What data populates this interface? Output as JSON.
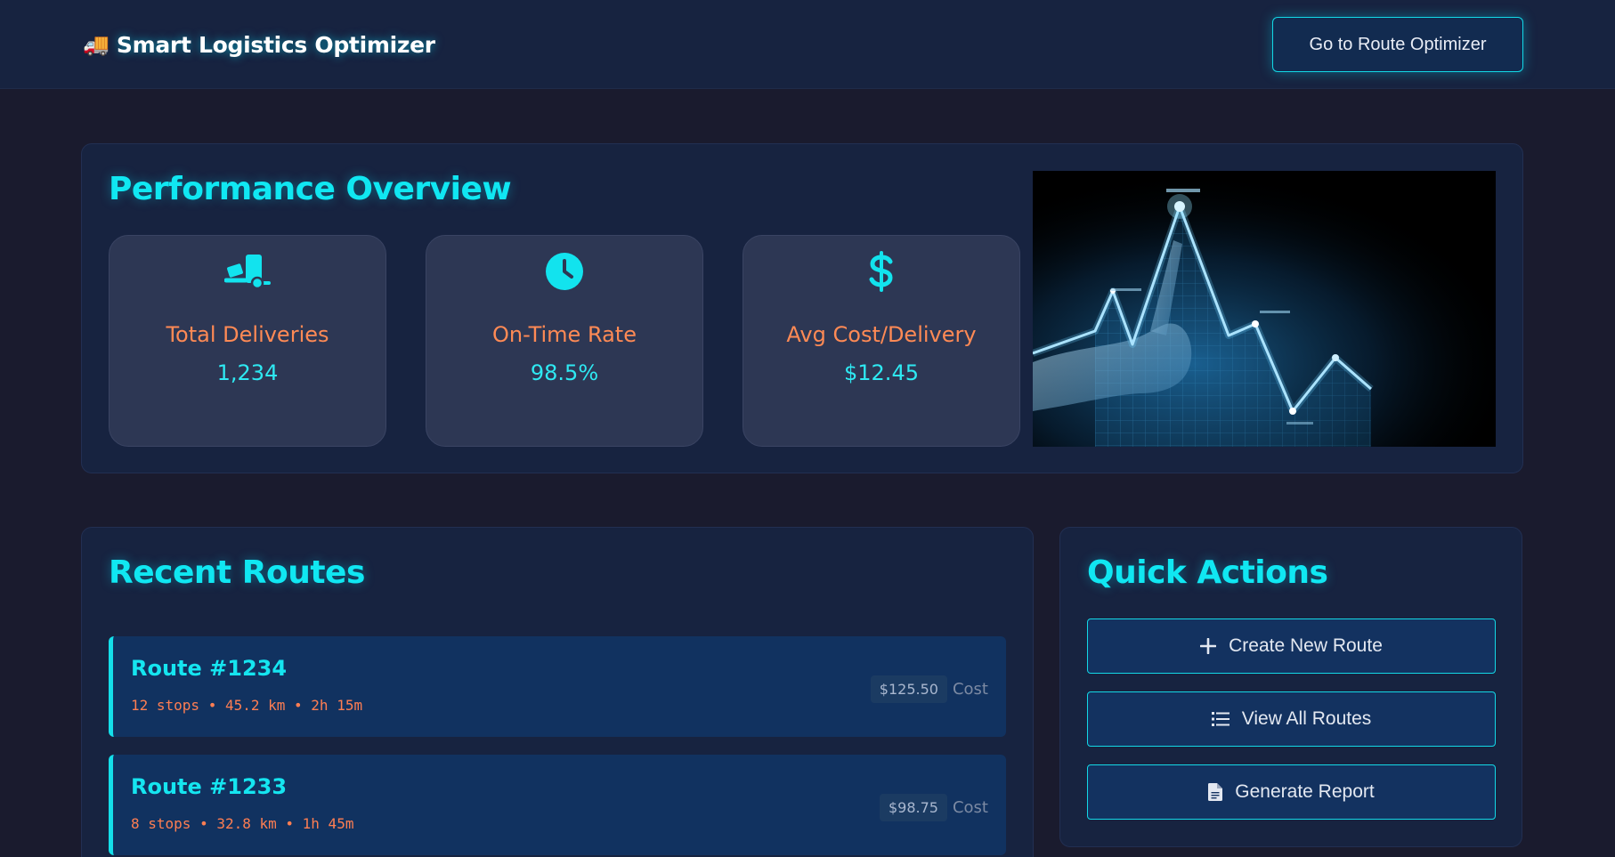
{
  "header": {
    "brand_icon": "🚚",
    "brand_title": "Smart Logistics Optimizer",
    "nav_button": "Go to Route Optimizer"
  },
  "overview": {
    "title": "Performance Overview",
    "stats": [
      {
        "icon": "truck-loading-icon",
        "label": "Total Deliveries",
        "value": "1,234"
      },
      {
        "icon": "clock-icon",
        "label": "On-Time Rate",
        "value": "98.5%"
      },
      {
        "icon": "dollar-icon",
        "label": "Avg Cost/Delivery",
        "value": "$12.45"
      }
    ],
    "image_alt": "growth-chart-hand-image"
  },
  "routes": {
    "title": "Recent Routes",
    "items": [
      {
        "name": "Route #1234",
        "meta": "12 stops • 45.2 km • 2h 15m",
        "cost": "$125.50",
        "cost_label": "Cost"
      },
      {
        "name": "Route #1233",
        "meta": "8 stops • 32.8 km • 1h 45m",
        "cost": "$98.75",
        "cost_label": "Cost"
      }
    ]
  },
  "quick_actions": {
    "title": "Quick Actions",
    "buttons": [
      {
        "icon": "plus-icon",
        "label": "Create New Route"
      },
      {
        "icon": "list-icon",
        "label": "View All Routes"
      },
      {
        "icon": "file-icon",
        "label": "Generate Report"
      }
    ]
  },
  "colors": {
    "accent": "#10e7f2",
    "label_orange": "#ff8a55",
    "panel": "#172340",
    "background": "#1a1b2e"
  }
}
